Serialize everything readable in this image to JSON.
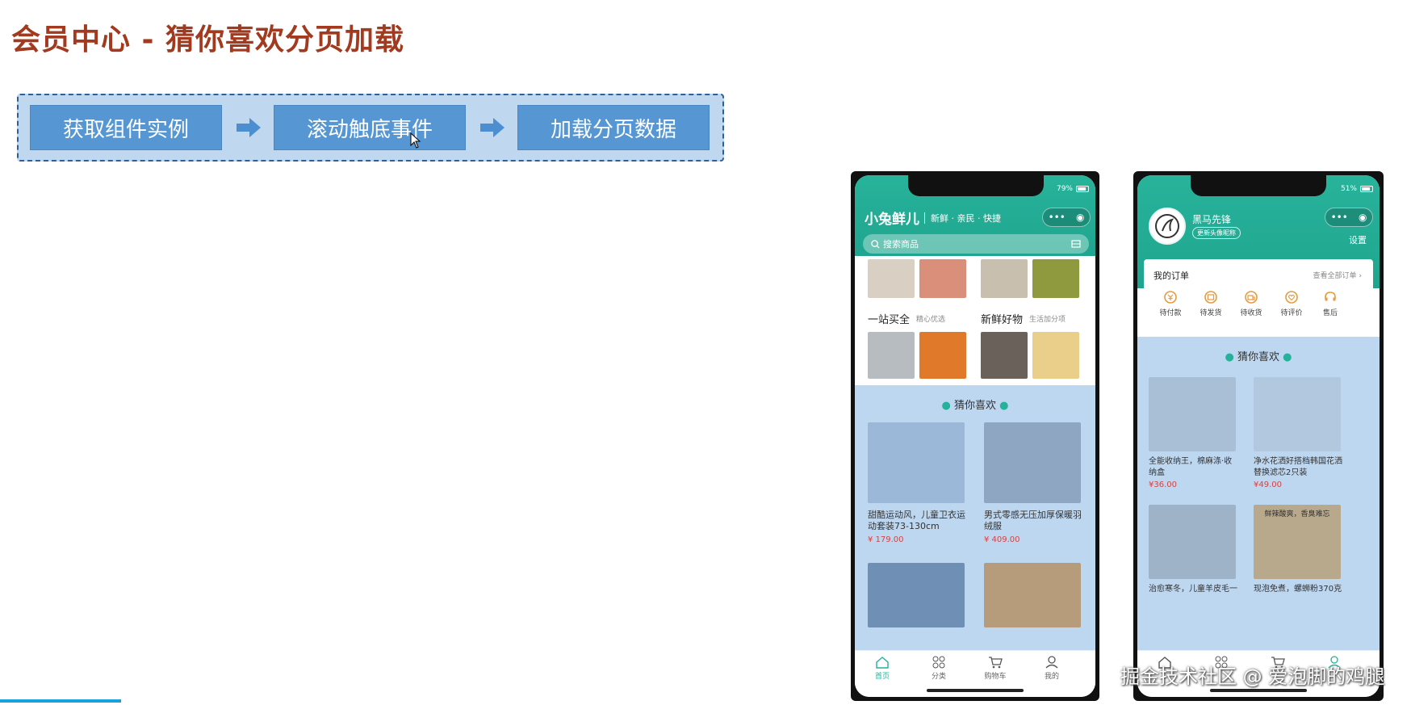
{
  "slide": {
    "title": "会员中心 - 猜你喜欢分页加载",
    "steps": [
      "获取组件实例",
      "滚动触底事件",
      "加载分页数据"
    ]
  },
  "phone_home": {
    "battery": "79%",
    "brand": "小兔鲜儿",
    "slogan": "新鲜 · 亲民 · 快捷",
    "search_placeholder": "搜索商品",
    "sections": [
      {
        "title": "一站买全",
        "sub": "精心优选"
      },
      {
        "title": "新鲜好物",
        "sub": "生活加分项"
      }
    ],
    "guess_title": "猜你喜欢",
    "products": [
      {
        "name": "甜酷运动风，儿童卫衣运动套装73-130cm",
        "price": "¥ 179.00"
      },
      {
        "name": "男式零感无压加厚保暖羽绒服",
        "price": "¥ 409.00"
      }
    ],
    "tabs": [
      "首页",
      "分类",
      "购物车",
      "我的"
    ]
  },
  "phone_member": {
    "battery": "51%",
    "nickname": "黑马先锋",
    "edit_badge": "更新头像昵称",
    "settings": "设置",
    "orders_title": "我的订单",
    "orders_all": "查看全部订单 ›",
    "order_types": [
      "待付款",
      "待发货",
      "待收货",
      "待评价",
      "售后"
    ],
    "guess_title": "猜你喜欢",
    "products": [
      {
        "name": "全能收纳王，棉麻涤·收纳盒",
        "price": "¥36.00"
      },
      {
        "name": "净水花洒好搭档韩国花洒替换滤芯2只装",
        "price": "¥49.00"
      },
      {
        "name": "治愈寒冬，儿童羊皮毛一",
        "price": ""
      },
      {
        "name": "现泡免煮，螺蛳粉370克",
        "price": ""
      }
    ],
    "food_banner": "鲜辣酸爽，香臭难忘"
  },
  "watermark": "掘金技术社区 @ 爱泡脚的鸡腿",
  "colors": {
    "title": "#a23a1f",
    "step": "#5596d3",
    "teal": "#27b09a",
    "price": "#cf4444"
  }
}
